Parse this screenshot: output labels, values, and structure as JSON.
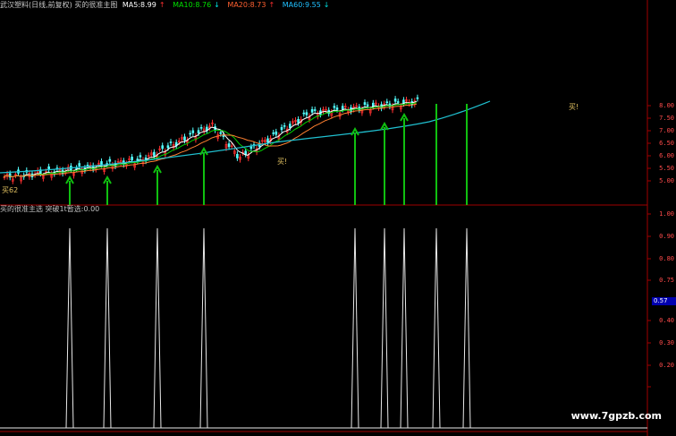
{
  "header": {
    "title": "武汉塑料(日线,前复权) 买的很准主图",
    "ma5": {
      "label": "MA5:8.99",
      "arrow": "↑",
      "color": "#ffffff"
    },
    "ma10": {
      "label": "MA10:8.76",
      "arrow": "↓",
      "color": "#00e000"
    },
    "ma20": {
      "label": "MA20:8.73",
      "arrow": "↑",
      "color": "#ff6030"
    },
    "ma60": {
      "label": "MA60:9.55",
      "arrow": "↓",
      "color": "#20c0ff"
    }
  },
  "subheader": {
    "label": "买的很准主选 突破1t暂选:0.00"
  },
  "signals": {
    "buy_label": "买!",
    "low_marker": "买62"
  },
  "price_axis": [
    "8.00",
    "7.50",
    "7.00",
    "6.50",
    "6.00",
    "5.50",
    "5.00"
  ],
  "indicator_axis": [
    "1.00",
    "0.90",
    "0.80",
    "0.75",
    "0.57",
    "0.40",
    "0.30",
    "0.20"
  ],
  "indicator_badge": "0.57",
  "watermark": "www.7gpzb.com",
  "colors": {
    "up": "#ff3030",
    "down": "#54ffff",
    "ma5": "#ffffff",
    "ma10": "#00d000",
    "ma20": "#ff8030",
    "ma60": "#20c0d0",
    "arrow": "#10c010"
  }
}
